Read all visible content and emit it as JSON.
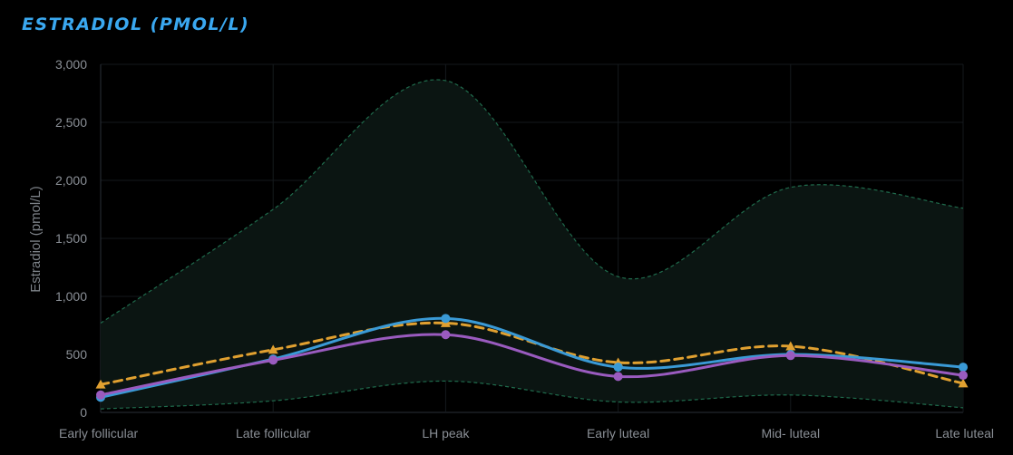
{
  "title": "ESTRADIOL (PMOL/L)",
  "chart_data": {
    "type": "line",
    "categories": [
      "Early follicular",
      "Late follicular",
      "LH peak",
      "Early luteal",
      "Mid- luteal",
      "Late luteal"
    ],
    "ylabel": "Estradiol (pmol/L)",
    "xlabel": "",
    "ylim": [
      0,
      3000
    ],
    "yticks": [
      0,
      500,
      1000,
      1500,
      2000,
      2500,
      3000
    ],
    "ytick_labels": [
      "0",
      "500",
      "1,000",
      "1,500",
      "2,000",
      "2,500",
      "3,000"
    ],
    "grid": true,
    "legend": "none",
    "band": {
      "upper": [
        770,
        1750,
        2860,
        1170,
        1940,
        1760
      ],
      "lower": [
        30,
        100,
        270,
        90,
        150,
        40
      ],
      "color": "#1f6b4c"
    },
    "series": [
      {
        "values": [
          240,
          540,
          770,
          430,
          570,
          250
        ],
        "color": "#e0a030",
        "style": "dashed",
        "marker": "triangle"
      },
      {
        "values": [
          130,
          460,
          810,
          390,
          500,
          390
        ],
        "color": "#3a9ad6",
        "style": "solid",
        "marker": "circle"
      },
      {
        "values": [
          150,
          450,
          670,
          310,
          490,
          320
        ],
        "color": "#9a5bbf",
        "style": "solid",
        "marker": "circle"
      }
    ]
  }
}
